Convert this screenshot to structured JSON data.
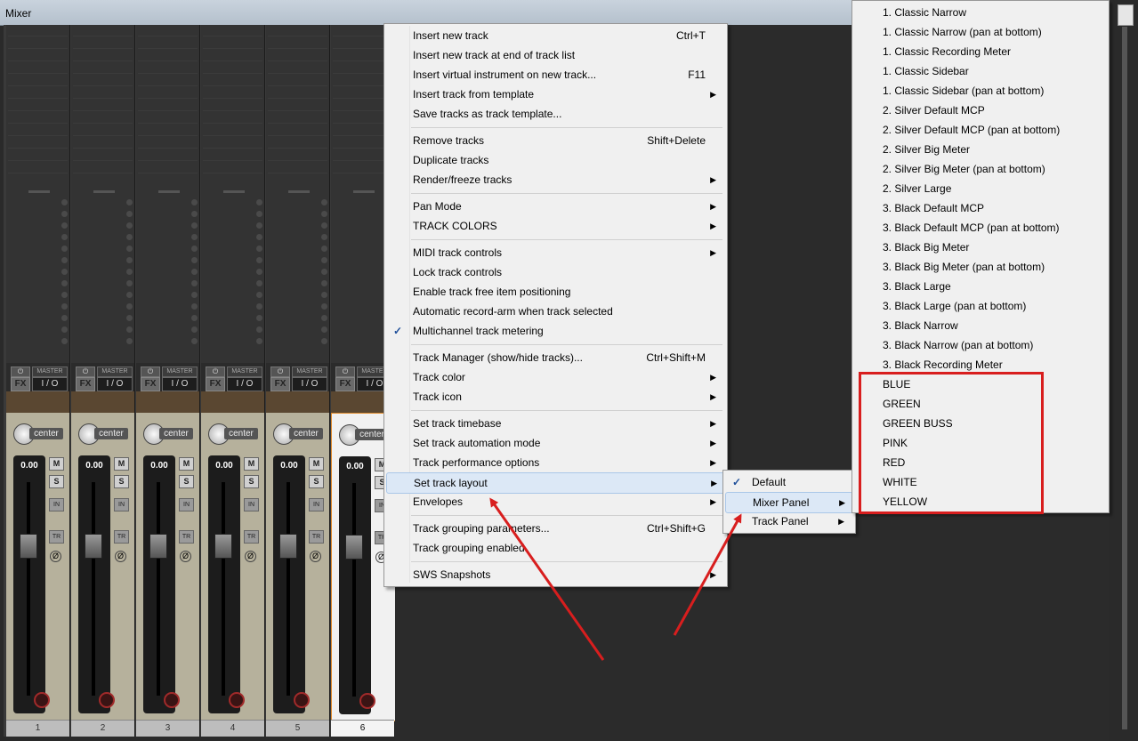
{
  "window": {
    "title": "Mixer"
  },
  "mixer": {
    "strips": [
      {
        "number": "1",
        "pan": "center",
        "volume": "0.00",
        "master": "MASTER",
        "io": "I / O",
        "fx": "FX",
        "selected": false
      },
      {
        "number": "2",
        "pan": "center",
        "volume": "0.00",
        "master": "MASTER",
        "io": "I / O",
        "fx": "FX",
        "selected": false
      },
      {
        "number": "3",
        "pan": "center",
        "volume": "0.00",
        "master": "MASTER",
        "io": "I / O",
        "fx": "FX",
        "selected": false
      },
      {
        "number": "4",
        "pan": "center",
        "volume": "0.00",
        "master": "MASTER",
        "io": "I / O",
        "fx": "FX",
        "selected": false
      },
      {
        "number": "5",
        "pan": "center",
        "volume": "0.00",
        "master": "MASTER",
        "io": "I / O",
        "fx": "FX",
        "selected": false
      },
      {
        "number": "6",
        "pan": "center",
        "volume": "0.00",
        "master": "MASTER",
        "io": "I / O",
        "fx": "FX",
        "selected": true
      }
    ],
    "buttons": {
      "mute": "M",
      "solo": "S",
      "in": "IN",
      "tr": "TR",
      "phase": "Ø",
      "power": "⏻"
    }
  },
  "context_menu": {
    "items": [
      {
        "label": "Insert new track",
        "shortcut": "Ctrl+T"
      },
      {
        "label": "Insert new track at end of track list"
      },
      {
        "label": "Insert virtual instrument on new track...",
        "shortcut": "F11"
      },
      {
        "label": "Insert track from template",
        "submenu": true
      },
      {
        "label": "Save tracks as track template..."
      },
      {
        "separator": true
      },
      {
        "label": "Remove tracks",
        "shortcut": "Shift+Delete"
      },
      {
        "label": "Duplicate tracks"
      },
      {
        "label": "Render/freeze tracks",
        "submenu": true
      },
      {
        "separator": true
      },
      {
        "label": "Pan Mode",
        "submenu": true
      },
      {
        "label": "TRACK COLORS",
        "submenu": true
      },
      {
        "separator": true
      },
      {
        "label": "MIDI track controls",
        "submenu": true
      },
      {
        "label": "Lock track controls"
      },
      {
        "label": "Enable track free item positioning"
      },
      {
        "label": "Automatic record-arm when track selected"
      },
      {
        "label": "Multichannel track metering",
        "checked": true
      },
      {
        "separator": true
      },
      {
        "label": "Track Manager (show/hide tracks)...",
        "shortcut": "Ctrl+Shift+M"
      },
      {
        "label": "Track color",
        "submenu": true
      },
      {
        "label": "Track icon",
        "submenu": true
      },
      {
        "separator": true
      },
      {
        "label": "Set track timebase",
        "submenu": true
      },
      {
        "label": "Set track automation mode",
        "submenu": true
      },
      {
        "label": "Track performance options",
        "submenu": true
      },
      {
        "label": "Set track layout",
        "submenu": true,
        "highlighted": true
      },
      {
        "label": "Envelopes",
        "submenu": true
      },
      {
        "separator": true
      },
      {
        "label": "Track grouping parameters...",
        "shortcut": "Ctrl+Shift+G"
      },
      {
        "label": "Track grouping enabled"
      },
      {
        "separator": true
      },
      {
        "label": "SWS Snapshots",
        "submenu": true
      }
    ]
  },
  "layout_submenu": {
    "items": [
      {
        "label": "Default",
        "checked": true
      },
      {
        "label": "Mixer Panel",
        "submenu": true,
        "highlighted": true
      },
      {
        "label": "Track Panel",
        "submenu": true
      }
    ]
  },
  "mixer_panel_layouts": {
    "items": [
      "1. Classic Narrow",
      "1. Classic Narrow (pan at bottom)",
      "1. Classic Recording Meter",
      "1. Classic Sidebar",
      "1. Classic Sidebar (pan at bottom)",
      "2.  Silver Default MCP",
      "2.  Silver Default MCP (pan at bottom)",
      "2. Silver Big Meter",
      "2. Silver Big Meter (pan at bottom)",
      "2. Silver Large",
      "3.  Black Default MCP",
      "3.  Black Default MCP (pan at bottom)",
      "3. Black Big Meter",
      "3. Black Big Meter (pan at bottom)",
      "3. Black Large",
      "3. Black Large (pan at bottom)",
      "3. Black Narrow",
      "3. Black Narrow (pan at bottom)",
      "3. Black Recording Meter",
      "BLUE",
      "GREEN",
      "GREEN BUSS",
      "PINK",
      "RED",
      "WHITE",
      "YELLOW"
    ]
  },
  "annotation": {
    "color": "#d81e1e"
  }
}
